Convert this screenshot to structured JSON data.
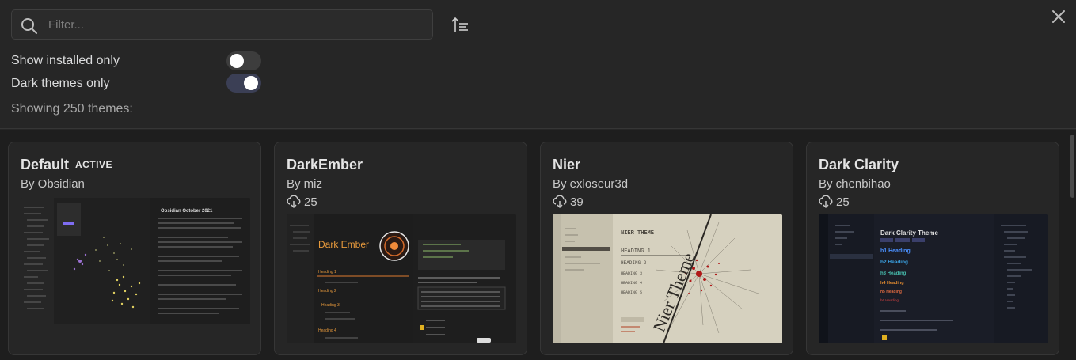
{
  "search": {
    "placeholder": "Filter..."
  },
  "filters": {
    "installed_label": "Show installed only",
    "installed_on": false,
    "dark_label": "Dark themes only",
    "dark_on": true
  },
  "count_text": "Showing 250 themes:",
  "themes": [
    {
      "name": "Default",
      "badge": "ACTIVE",
      "author": "By Obsidian",
      "downloads": "",
      "preview_title": "Obsidian October 2021"
    },
    {
      "name": "DarkEmber",
      "badge": "",
      "author": "By miz",
      "downloads": "25",
      "preview_title": "Dark Ember"
    },
    {
      "name": "Nier",
      "badge": "",
      "author": "By exloseur3d",
      "downloads": "39",
      "preview_title": "NIER THEME"
    },
    {
      "name": "Dark Clarity",
      "badge": "",
      "author": "By chenbihao",
      "downloads": "25",
      "preview_title": "Dark Clarity Theme"
    }
  ],
  "colors": {
    "background": "#262626",
    "grid_bg": "#1e1e1e",
    "accent": "#7f6df2",
    "toggle_on": "#3b3f55"
  }
}
